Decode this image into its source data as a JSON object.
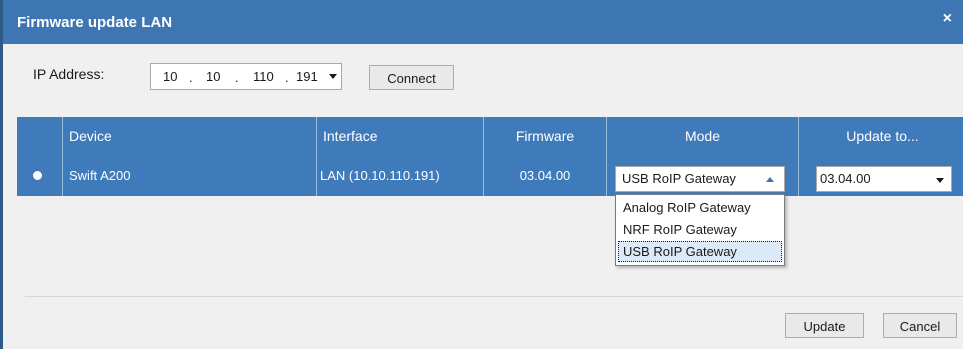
{
  "window": {
    "title": "Firmware update LAN",
    "close_glyph": "×"
  },
  "ip": {
    "label": "IP Address:",
    "octets": [
      "10",
      "10",
      "110",
      "191"
    ],
    "separator": ".",
    "connect_label": "Connect"
  },
  "table": {
    "columns": [
      "Device",
      "Interface",
      "Firmware",
      "Mode",
      "Update to..."
    ],
    "rows": [
      {
        "selected": true,
        "device": "Swift A200",
        "interface": "LAN (10.10.110.191)",
        "firmware": "03.04.00",
        "mode": "USB RoIP Gateway",
        "update_to": "03.04.00"
      }
    ]
  },
  "mode_dropdown": {
    "open": true,
    "options": [
      "Analog RoIP Gateway",
      "NRF RoIP Gateway",
      "USB RoIP Gateway"
    ],
    "selected": "USB RoIP Gateway"
  },
  "footer": {
    "update_label": "Update",
    "cancel_label": "Cancel"
  },
  "colors": {
    "titlebar": "#3d76b3",
    "grid_header": "#3f7bbb",
    "window_bg": "#f0f0f0"
  }
}
